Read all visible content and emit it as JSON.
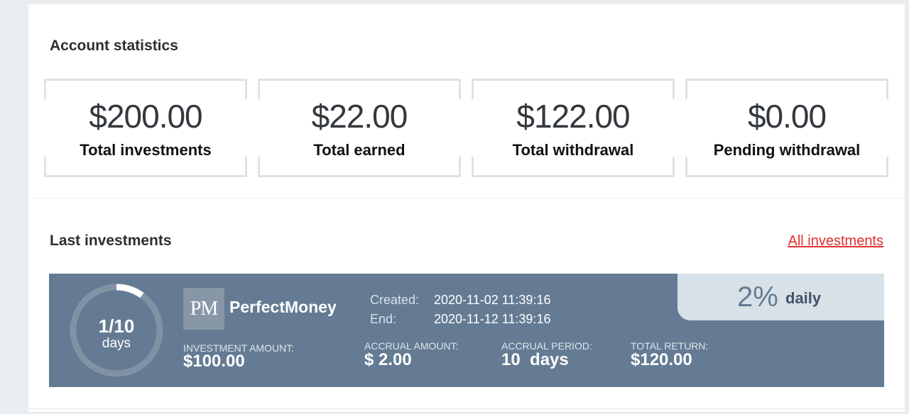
{
  "account_statistics": {
    "title": "Account statistics",
    "cards": [
      {
        "value": "$200.00",
        "label": "Total investments"
      },
      {
        "value": "$22.00",
        "label": "Total earned"
      },
      {
        "value": "$122.00",
        "label": "Total withdrawal"
      },
      {
        "value": "$0.00",
        "label": "Pending withdrawal"
      }
    ]
  },
  "last_investments": {
    "title": "Last investments",
    "all_link": "All investments",
    "investment": {
      "progress": {
        "text": "1/10",
        "unit": "days",
        "fraction": 0.1
      },
      "logo_text": "PM",
      "payment_system": "PerfectMoney",
      "created_label": "Created:",
      "created_value": "2020-11-02 11:39:16",
      "end_label": "End:",
      "end_value": "2020-11-12 11:39:16",
      "investment_amount_label": "INVESTMENT AMOUNT:",
      "investment_amount": "$100.00",
      "accrual_amount_label": "ACCRUAL AMOUNT:",
      "accrual_amount": "$ 2.00",
      "accrual_period_label": "ACCRUAL PERIOD:",
      "accrual_period": "10  days",
      "total_return_label": "TOTAL RETURN:",
      "total_return": "$120.00",
      "rate_percent": "2%",
      "rate_word": "daily"
    }
  },
  "colors": {
    "card_background": "#647b93",
    "link": "#e23030",
    "rate_box": "#d8e1e7"
  }
}
